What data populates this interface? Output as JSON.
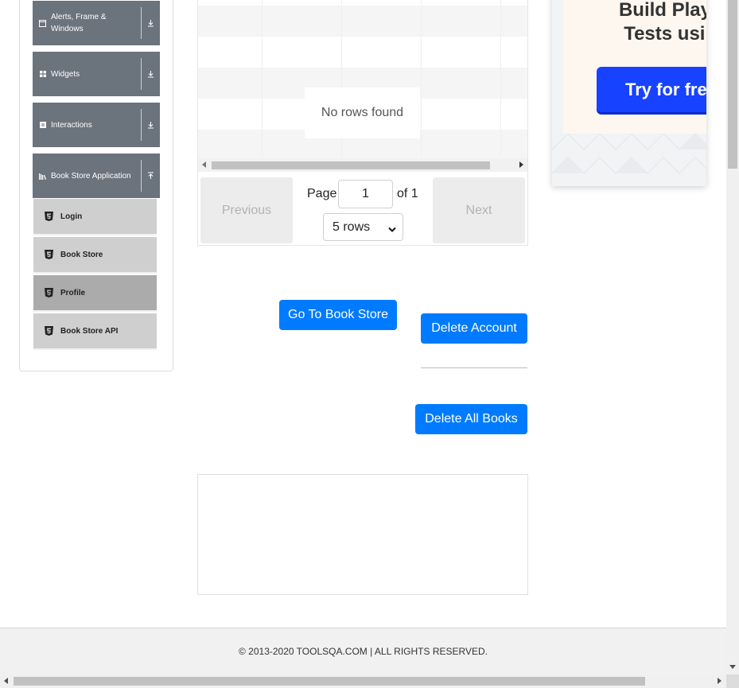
{
  "sidebar": {
    "groups": [
      {
        "label": "Alerts, Frame & Windows",
        "icon": "window-icon",
        "arrow": "download-arrow-icon"
      },
      {
        "label": "Widgets",
        "icon": "grid-icon",
        "arrow": "download-arrow-icon"
      },
      {
        "label": "Interactions",
        "icon": "interactions-icon",
        "arrow": "download-arrow-icon"
      },
      {
        "label": "Book Store Application",
        "icon": "bookshelf-icon",
        "arrow": "upload-arrow-icon"
      }
    ],
    "items": [
      {
        "label": "Login",
        "icon": "html5-icon"
      },
      {
        "label": "Book Store",
        "icon": "html5-icon"
      },
      {
        "label": "Profile",
        "icon": "html5-icon",
        "active": true
      },
      {
        "label": "Book Store API",
        "icon": "html5-icon"
      }
    ]
  },
  "table": {
    "empty_message": "No rows found",
    "pagination": {
      "previous_label": "Previous",
      "next_label": "Next",
      "page_label": "Page",
      "current_page": "1",
      "of_label": "of 1",
      "rows_option": "5 rows"
    }
  },
  "actions": {
    "go_to_store": "Go To Book Store",
    "delete_account": "Delete Account",
    "delete_all_books": "Delete All Books"
  },
  "ad": {
    "title_line1": "Build Playwr",
    "title_line2": "Tests using",
    "cta": "Try for free"
  },
  "footer": {
    "copyright": "© 2013-2020 TOOLSQA.COM | ALL RIGHTS RESERVED."
  },
  "colors": {
    "primary": "#007bff",
    "sidebar_header": "#6b737d",
    "sidebar_item": "#cfcfcf",
    "sidebar_item_active": "#ababab",
    "ad_button": "#1742ff"
  }
}
